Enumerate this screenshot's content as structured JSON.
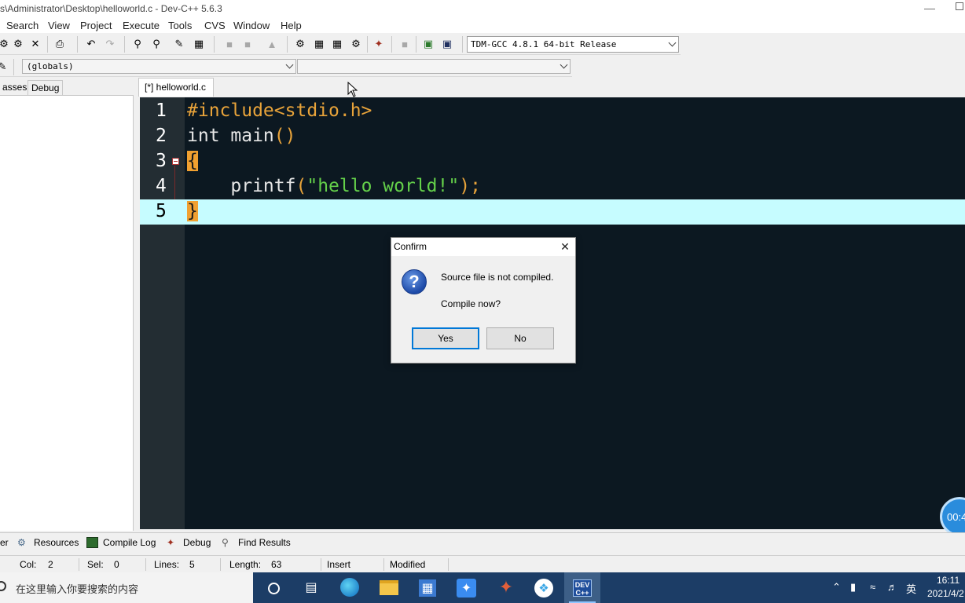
{
  "window": {
    "title": "s\\Administrator\\Desktop\\helloworld.c - Dev-C++ 5.6.3"
  },
  "menu": [
    "Search",
    "View",
    "Project",
    "Execute",
    "Tools",
    "CVS",
    "Window",
    "Help"
  ],
  "toolbar": {
    "compiler": "TDM-GCC 4.8.1 64-bit Release",
    "scope": "(globals)"
  },
  "left_panel": {
    "tabs": [
      "asses",
      "Debug"
    ]
  },
  "editor": {
    "tab_label": "[*] helloworld.c",
    "lines": [
      {
        "num": "1",
        "text": "#include<stdio.h>"
      },
      {
        "num": "2",
        "text": "int main()"
      },
      {
        "num": "3",
        "text": "{"
      },
      {
        "num": "4",
        "text": "    printf(\"hello world!\");"
      },
      {
        "num": "5",
        "text": "}"
      }
    ],
    "current_line": 5
  },
  "dialog": {
    "title": "Confirm",
    "message": "Source file is not compiled.",
    "question": "Compile now?",
    "yes_label": "Yes",
    "no_label": "No",
    "icon": "question-icon"
  },
  "timer": "00:4",
  "bottom_tabs": [
    "er",
    "Resources",
    "Compile Log",
    "Debug",
    "Find Results"
  ],
  "status": {
    "col_label": "Col:",
    "col_value": "2",
    "sel_label": "Sel:",
    "sel_value": "0",
    "lines_label": "Lines:",
    "lines_value": "5",
    "length_label": "Length:",
    "length_value": "63",
    "mode": "Insert",
    "modified": "Modified"
  },
  "taskbar": {
    "search_placeholder": "在这里输入你要搜索的内容",
    "ime": "英",
    "time": "16:11",
    "date": "2021/4/2"
  }
}
